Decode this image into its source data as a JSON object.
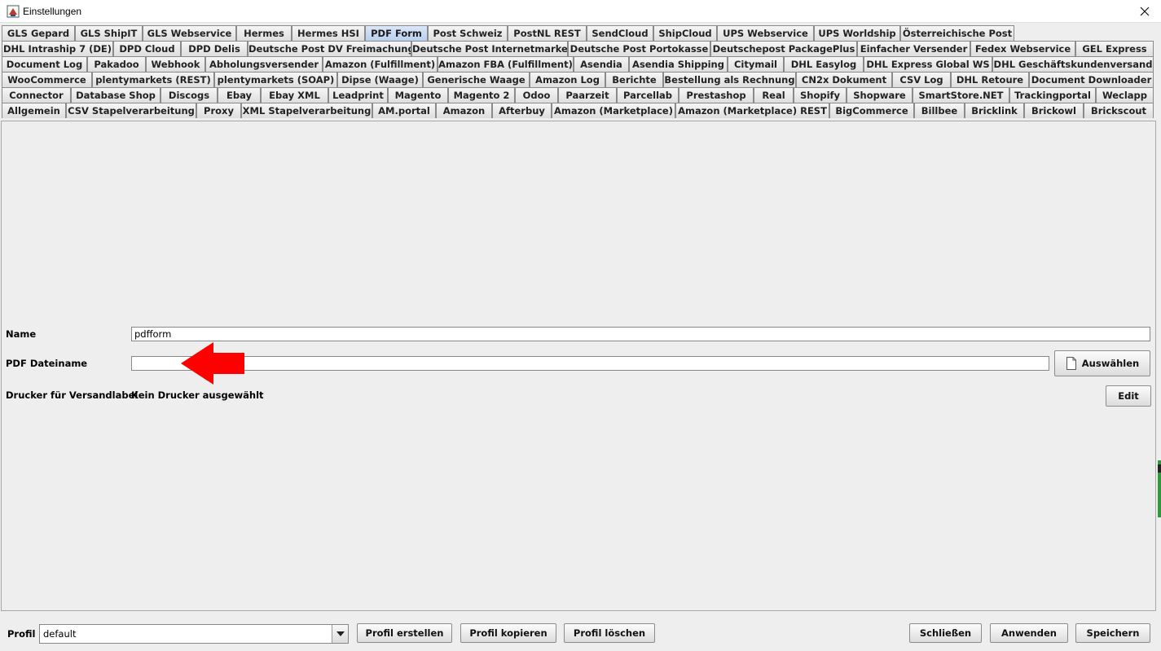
{
  "window": {
    "title": "Einstellungen",
    "close_icon": "close-icon",
    "app_icon": "java-app-icon"
  },
  "tab_rows": [
    [
      "GLS Gepard",
      "GLS ShipIT",
      "GLS Webservice",
      "Hermes",
      "Hermes HSI",
      "PDF Form",
      "Post Schweiz",
      "PostNL REST",
      "SendCloud",
      "ShipCloud",
      "UPS Webservice",
      "UPS Worldship",
      "Österreichische Post"
    ],
    [
      "DHL Intraship 7 (DE)",
      "DPD Cloud",
      "DPD Delis",
      "Deutsche Post DV Freimachung",
      "Deutsche Post Internetmarke",
      "Deutsche Post Portokasse",
      "Deutschepost PackagePlus",
      "Einfacher Versender",
      "Fedex Webservice",
      "GEL Express"
    ],
    [
      "Document Log",
      "Pakadoo",
      "Webhook",
      "Abholungsversender",
      "Amazon (Fulfillment)",
      "Amazon FBA (Fulfillment)",
      "Asendia",
      "Asendia Shipping",
      "Citymail",
      "DHL Easylog",
      "DHL Express Global WS",
      "DHL Geschäftskundenversand"
    ],
    [
      "WooCommerce",
      "plentymarkets (REST)",
      "plentymarkets (SOAP)",
      "Dipse (Waage)",
      "Generische Waage",
      "Amazon Log",
      "Berichte",
      "Bestellung als Rechnung",
      "CN2x Dokument",
      "CSV Log",
      "DHL Retoure",
      "Document Downloader"
    ],
    [
      "Connector",
      "Database Shop",
      "Discogs",
      "Ebay",
      "Ebay XML",
      "Leadprint",
      "Magento",
      "Magento 2",
      "Odoo",
      "Paarzeit",
      "Parcellab",
      "Prestashop",
      "Real",
      "Shopify",
      "Shopware",
      "SmartStore.NET",
      "Trackingportal",
      "Weclapp"
    ],
    [
      "Allgemein",
      "CSV Stapelverarbeitung",
      "Proxy",
      "XML Stapelverarbeitung",
      "AM.portal",
      "Amazon",
      "Afterbuy",
      "Amazon (Marketplace)",
      "Amazon (Marketplace) REST",
      "BigCommerce",
      "Billbee",
      "Bricklink",
      "Brickowl",
      "Brickscout"
    ]
  ],
  "selected_tab": "PDF Form",
  "form": {
    "name_label": "Name",
    "name_value": "pdfform",
    "pdf_label": "PDF Dateiname",
    "pdf_value": "",
    "choose_label": "Auswählen",
    "choose_icon": "file-icon",
    "printer_label": "Drucker für Versandlabel",
    "printer_value": "Kein Drucker ausgewählt",
    "edit_label": "Edit",
    "annotation_icon": "red-arrow-icon"
  },
  "footer": {
    "profile_label": "Profil",
    "profile_value": "default",
    "create_label": "Profil erstellen",
    "copy_label": "Profil kopieren",
    "delete_label": "Profil löschen",
    "close_label": "Schließen",
    "apply_label": "Anwenden",
    "save_label": "Speichern"
  }
}
